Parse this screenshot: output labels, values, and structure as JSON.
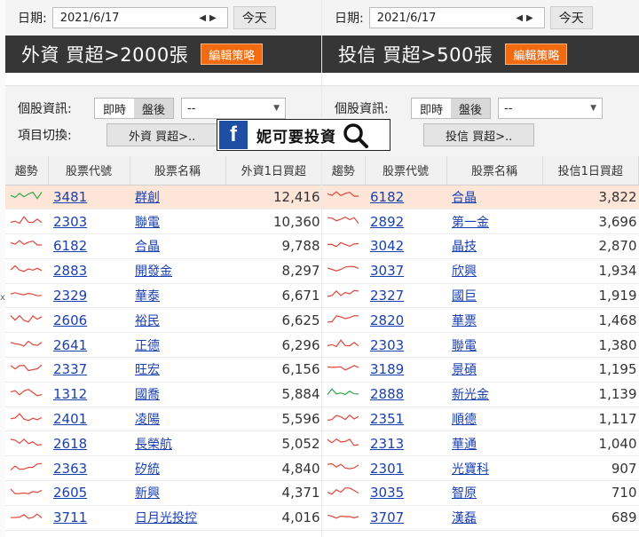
{
  "common": {
    "date_label": "日期:",
    "date_value": "2021/6/17",
    "today_label": "今天",
    "strategy_label": "編輯策略",
    "info_label": "個股資訊:",
    "realtime_label": "即時",
    "after_label": "盤後",
    "select_value": "--",
    "switch_label": "項目切換:"
  },
  "left": {
    "title": "外資 買超>2000張",
    "switch_btn": "外資 買超>..",
    "headers": [
      "趨勢",
      "股票代號",
      "股票名稱",
      "外資1日買超"
    ],
    "rows": [
      {
        "code": "3481",
        "name": "群創",
        "value": "12,416",
        "trend": "green"
      },
      {
        "code": "2303",
        "name": "聯電",
        "value": "10,360",
        "trend": "red"
      },
      {
        "code": "6182",
        "name": "合晶",
        "value": "9,788",
        "trend": "red"
      },
      {
        "code": "2883",
        "name": "開發金",
        "value": "8,297",
        "trend": "red"
      },
      {
        "code": "2329",
        "name": "華泰",
        "value": "6,671",
        "trend": "red"
      },
      {
        "code": "2606",
        "name": "裕民",
        "value": "6,625",
        "trend": "red"
      },
      {
        "code": "2641",
        "name": "正德",
        "value": "6,296",
        "trend": "red"
      },
      {
        "code": "2337",
        "name": "旺宏",
        "value": "6,156",
        "trend": "red"
      },
      {
        "code": "1312",
        "name": "國喬",
        "value": "5,884",
        "trend": "red"
      },
      {
        "code": "2401",
        "name": "凌陽",
        "value": "5,596",
        "trend": "red"
      },
      {
        "code": "2618",
        "name": "長榮航",
        "value": "5,052",
        "trend": "red"
      },
      {
        "code": "2363",
        "name": "矽統",
        "value": "4,840",
        "trend": "red"
      },
      {
        "code": "2605",
        "name": "新興",
        "value": "4,371",
        "trend": "red"
      },
      {
        "code": "3711",
        "name": "日月光投控",
        "value": "4,016",
        "trend": "red"
      }
    ]
  },
  "right": {
    "title": "投信 買超>500張",
    "switch_btn": "投信 買超>..",
    "headers": [
      "趨勢",
      "股票代號",
      "股票名稱",
      "投信1日買超"
    ],
    "rows": [
      {
        "code": "6182",
        "name": "合晶",
        "value": "3,822",
        "trend": "red"
      },
      {
        "code": "2892",
        "name": "第一金",
        "value": "3,696",
        "trend": "red"
      },
      {
        "code": "3042",
        "name": "晶技",
        "value": "2,870",
        "trend": "red"
      },
      {
        "code": "3037",
        "name": "欣興",
        "value": "1,934",
        "trend": "red"
      },
      {
        "code": "2327",
        "name": "國巨",
        "value": "1,919",
        "trend": "red"
      },
      {
        "code": "2820",
        "name": "華票",
        "value": "1,468",
        "trend": "red"
      },
      {
        "code": "2303",
        "name": "聯電",
        "value": "1,380",
        "trend": "red"
      },
      {
        "code": "3189",
        "name": "景碩",
        "value": "1,195",
        "trend": "red"
      },
      {
        "code": "2888",
        "name": "新光金",
        "value": "1,139",
        "trend": "green"
      },
      {
        "code": "2351",
        "name": "順德",
        "value": "1,117",
        "trend": "red"
      },
      {
        "code": "2313",
        "name": "華通",
        "value": "1,040",
        "trend": "red"
      },
      {
        "code": "2301",
        "name": "光寶科",
        "value": "907",
        "trend": "red"
      },
      {
        "code": "3035",
        "name": "智原",
        "value": "710",
        "trend": "red"
      },
      {
        "code": "3707",
        "name": "漢磊",
        "value": "689",
        "trend": "red"
      }
    ]
  },
  "overlay": {
    "logo_letter": "f",
    "text": "妮可要投資"
  },
  "colors": {
    "trend_red": "#e0463a",
    "trend_green": "#2fa84a",
    "accent": "#f36b10",
    "title_bg": "#363636",
    "link": "#1a3fb0",
    "highlight_row": "#fde6d8"
  }
}
